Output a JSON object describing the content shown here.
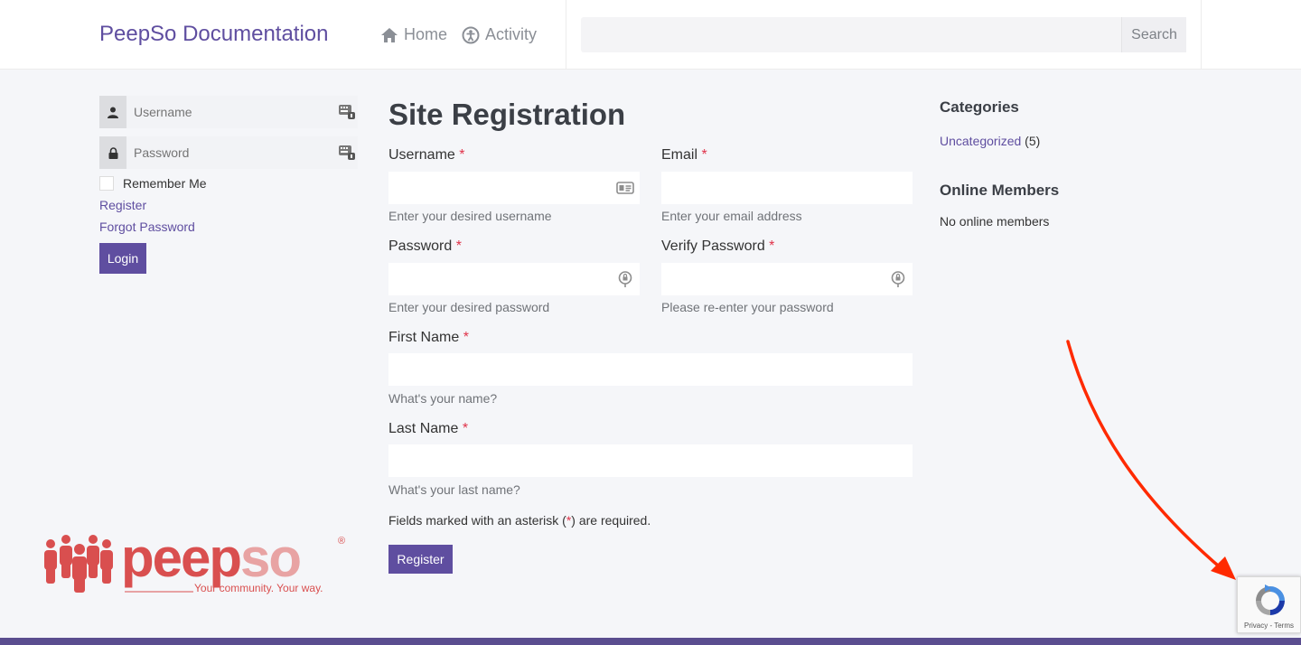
{
  "header": {
    "brand": "PeepSo Documentation",
    "nav": [
      {
        "label": "Home",
        "icon": "home-icon"
      },
      {
        "label": "Activity",
        "icon": "activity-icon"
      }
    ],
    "search_button": "Search",
    "search_placeholder": ""
  },
  "login_widget": {
    "username_placeholder": "Username",
    "password_placeholder": "Password",
    "remember_label": "Remember Me",
    "register_link": "Register",
    "forgot_link": "Forgot Password",
    "login_button": "Login"
  },
  "logo": {
    "wordmark": "peepso",
    "tagline": "Your community. Your way.",
    "registered_mark": "®"
  },
  "registration": {
    "title": "Site Registration",
    "required_mark": "*",
    "fields": {
      "username": {
        "label": "Username",
        "hint": "Enter your desired username"
      },
      "email": {
        "label": "Email",
        "hint": "Enter your email address"
      },
      "password": {
        "label": "Password",
        "hint": "Enter your desired password"
      },
      "verify_password": {
        "label": "Verify Password",
        "hint": "Please re-enter your password"
      },
      "first_name": {
        "label": "First Name",
        "hint": "What's your name?"
      },
      "last_name": {
        "label": "Last Name",
        "hint": "What's your last name?"
      }
    },
    "required_note_pre": "Fields marked with an asterisk (",
    "required_note_post": ") are required.",
    "register_button": "Register"
  },
  "sidebar": {
    "categories_heading": "Categories",
    "category_link": "Uncategorized",
    "category_count": "(5)",
    "online_heading": "Online Members",
    "online_text": "No online members"
  },
  "recaptcha": {
    "links": "Privacy - Terms"
  },
  "colors": {
    "accent": "#5f4ea0",
    "required": "#e0334a",
    "logo_red": "#d94f4f",
    "logo_pink": "#e8a3a3",
    "arrow": "#ff2a00"
  }
}
